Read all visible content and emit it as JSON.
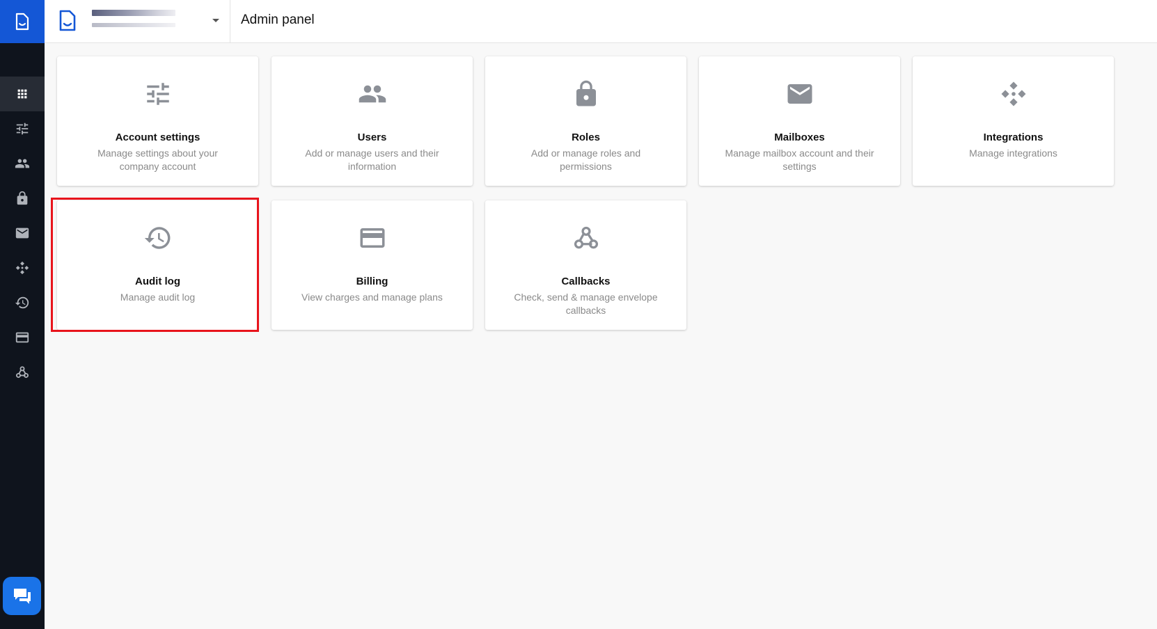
{
  "header": {
    "title": "Admin panel",
    "workspace_selector_icon": "document-smile-icon",
    "workspace_caret_icon": "caret-down-icon"
  },
  "rail": {
    "logo_icon": "document-icon",
    "items": [
      {
        "name": "apps-grid-icon",
        "active": true
      },
      {
        "name": "sliders-icon",
        "active": false
      },
      {
        "name": "users-icon",
        "active": false
      },
      {
        "name": "lock-icon",
        "active": false
      },
      {
        "name": "mail-icon",
        "active": false
      },
      {
        "name": "integrations-icon",
        "active": false
      },
      {
        "name": "history-icon",
        "active": false
      },
      {
        "name": "credit-card-icon",
        "active": false
      },
      {
        "name": "webhook-icon",
        "active": false
      }
    ],
    "chat_icon": "chat-icon"
  },
  "cards": [
    {
      "title": "Account settings",
      "desc": "Manage settings about your company account",
      "icon": "sliders-icon"
    },
    {
      "title": "Users",
      "desc": "Add or manage users and their information",
      "icon": "users-icon"
    },
    {
      "title": "Roles",
      "desc": "Add or manage roles and permissions",
      "icon": "lock-icon"
    },
    {
      "title": "Mailboxes",
      "desc": "Manage mailbox account and their settings",
      "icon": "mail-icon"
    },
    {
      "title": "Integrations",
      "desc": "Manage integrations",
      "icon": "integrations-icon"
    },
    {
      "title": "Audit log",
      "desc": "Manage audit log",
      "icon": "history-icon"
    },
    {
      "title": "Billing",
      "desc": "View charges and manage plans",
      "icon": "credit-card-icon"
    },
    {
      "title": "Callbacks",
      "desc": "Check, send & manage envelope callbacks",
      "icon": "webhook-icon"
    }
  ],
  "colors": {
    "rail_bg": "#0f141d",
    "brand_blue": "#1457d6",
    "icon_gray": "#8c9097",
    "highlight_red": "#e8141c"
  }
}
